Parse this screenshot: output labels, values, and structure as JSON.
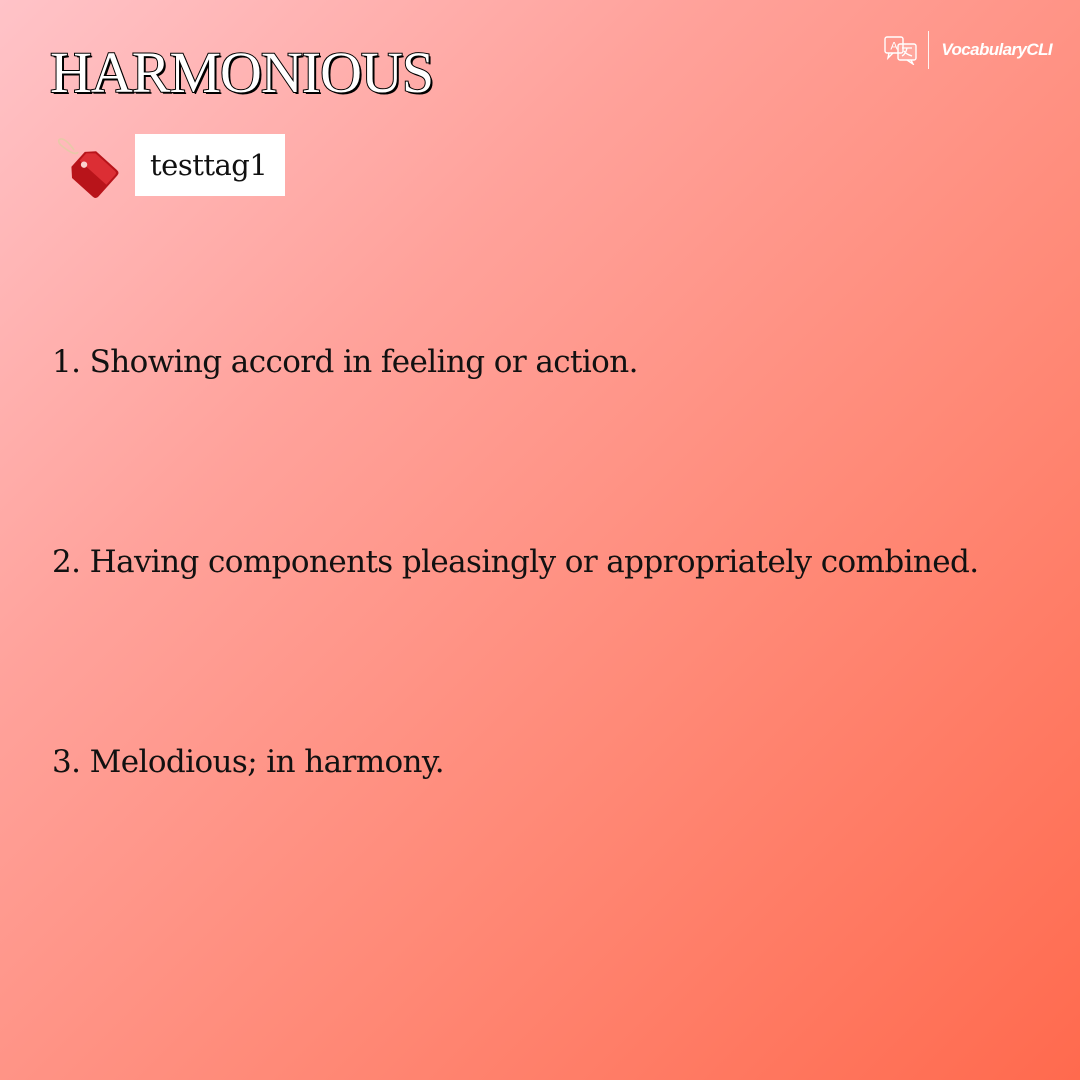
{
  "word": {
    "title": "HARMONIOUS"
  },
  "tag": {
    "label": "testtag1",
    "icon": "tag-icon"
  },
  "brand": {
    "name": "VocabularyCLI",
    "icon": "translate-icon"
  },
  "definitions": [
    "1. Showing accord in feeling or action.",
    "2. Having components pleasingly or appropriately combined.",
    "3. Melodious; in harmony."
  ],
  "colors": {
    "background_start": "#ffc3c8",
    "background_end": "#ff6a4e",
    "tag_icon": "#c8161d",
    "text": "#111111"
  }
}
